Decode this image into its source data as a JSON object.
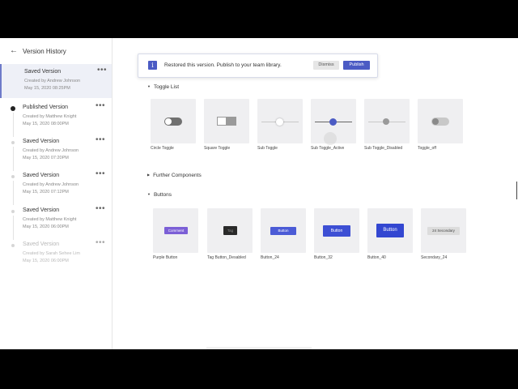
{
  "sidebar": {
    "title": "Version History",
    "back_icon": "arrow-left-icon",
    "versions": [
      {
        "name": "Saved Version",
        "by": "Created by Andrew Johnson",
        "date": "May 15, 2020 08:25PM"
      },
      {
        "name": "Published Version",
        "by": "Created by Matthew Knight",
        "date": "May 15, 2020 08:00PM"
      },
      {
        "name": "Saved Version",
        "by": "Created by Andrew Johnson",
        "date": "May 15, 2020 07:20PM"
      },
      {
        "name": "Saved Version",
        "by": "Created by Andrew Johnson",
        "date": "May 15, 2020 07:12PM"
      },
      {
        "name": "Saved Version",
        "by": "Created by Matthew Knight",
        "date": "May 15, 2020 06:00PM"
      },
      {
        "name": "Saved Version",
        "by": "Created by Sarah Sehee Lim",
        "date": "May 15, 2020 06:00PM"
      }
    ],
    "more_label": "•••"
  },
  "banner": {
    "icon": "i",
    "message": "Restored this version. Publish to your team library.",
    "dismiss_label": "Dismiss",
    "publish_label": "Publish"
  },
  "sections": {
    "toggle_list": "Toggle List",
    "further_components": "Further Components",
    "buttons": "Buttons"
  },
  "toggles": [
    {
      "label": "Circle Toggle"
    },
    {
      "label": "Square Toggle"
    },
    {
      "label": "Sub Toggle"
    },
    {
      "label": "Sub Toggle_Active"
    },
    {
      "label": "Sub Toggle_Disabled"
    },
    {
      "label": "Toggle_off"
    }
  ],
  "buttons": [
    {
      "label": "Purple Button",
      "text": "Comment",
      "color": "#7b5fd6"
    },
    {
      "label": "Tag Button_Desabled",
      "text": "Tag",
      "color": "#2a2a2a"
    },
    {
      "label": "Button_24",
      "text": "Button",
      "color": "#4b5bd6"
    },
    {
      "label": "Button_32",
      "text": "Button",
      "color": "#3d4fd4"
    },
    {
      "label": "Button_40",
      "text": "Button",
      "color": "#3347d1"
    },
    {
      "label": "Secondary_24",
      "text": "24 Secondary",
      "color": "#dcdcdc"
    }
  ],
  "colors": {
    "accent": "#4b5bc4",
    "tile": "#efeff1",
    "selected_row": "#eef0f7"
  }
}
